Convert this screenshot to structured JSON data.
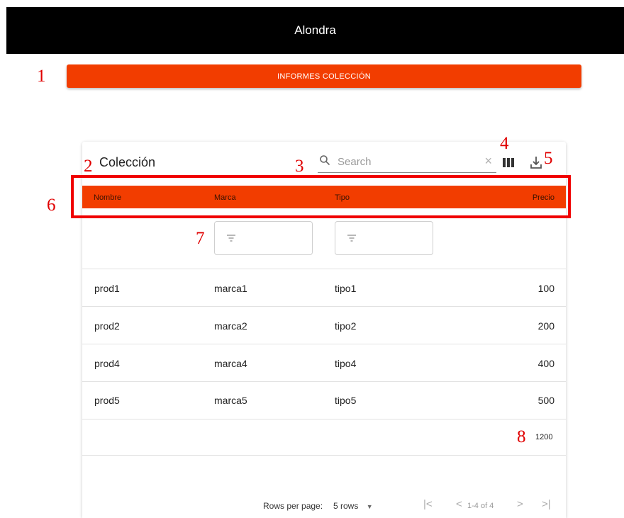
{
  "app": {
    "title": "Alondra"
  },
  "report_button": {
    "label": "INFORMES COLECCIÓN"
  },
  "table": {
    "title": "Colección",
    "search": {
      "placeholder": "Search",
      "value": ""
    },
    "columns": [
      "Nombre",
      "Marca",
      "Tipo",
      "Precio"
    ],
    "rows": [
      {
        "nombre": "prod1",
        "marca": "marca1",
        "tipo": "tipo1",
        "precio": "100"
      },
      {
        "nombre": "prod2",
        "marca": "marca2",
        "tipo": "tipo2",
        "precio": "200"
      },
      {
        "nombre": "prod4",
        "marca": "marca4",
        "tipo": "tipo4",
        "precio": "400"
      },
      {
        "nombre": "prod5",
        "marca": "marca5",
        "tipo": "tipo5",
        "precio": "500"
      }
    ],
    "total": "1200",
    "pagination": {
      "rows_per_page_label": "Rows per page:",
      "rows_per_page_value": "5 rows",
      "range": "1-4 of 4"
    },
    "icons": [
      "search-icon",
      "clear-icon",
      "view-column-icon",
      "download-icon",
      "filter-icon",
      "first-page-icon",
      "prev-page-icon",
      "next-page-icon",
      "last-page-icon",
      "dropdown-arrow-icon"
    ]
  },
  "annotations": [
    "1",
    "2",
    "3",
    "4",
    "5",
    "6",
    "7",
    "8"
  ],
  "colors": {
    "topbar": "#000000",
    "accent": "#f23d00",
    "highlight": "#f00000",
    "annotation": "#e00000"
  }
}
